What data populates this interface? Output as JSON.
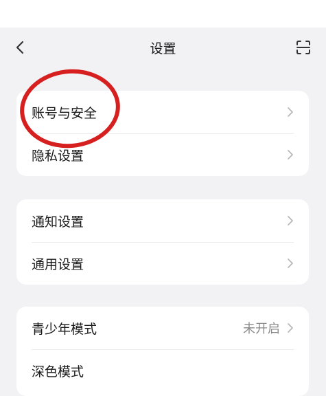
{
  "header": {
    "title": "设置",
    "back_icon": "chevron-left-icon",
    "scan_icon": "scan-icon"
  },
  "groups": [
    {
      "items": [
        {
          "label": "账号与安全"
        },
        {
          "label": "隐私设置"
        }
      ]
    },
    {
      "items": [
        {
          "label": "通知设置"
        },
        {
          "label": "通用设置"
        }
      ]
    },
    {
      "items": [
        {
          "label": "青少年模式",
          "value": "未开启"
        },
        {
          "label": "深色模式"
        }
      ]
    }
  ],
  "colors": {
    "background": "#f2f2f4",
    "card": "#ffffff",
    "highlight": "#d62020"
  }
}
